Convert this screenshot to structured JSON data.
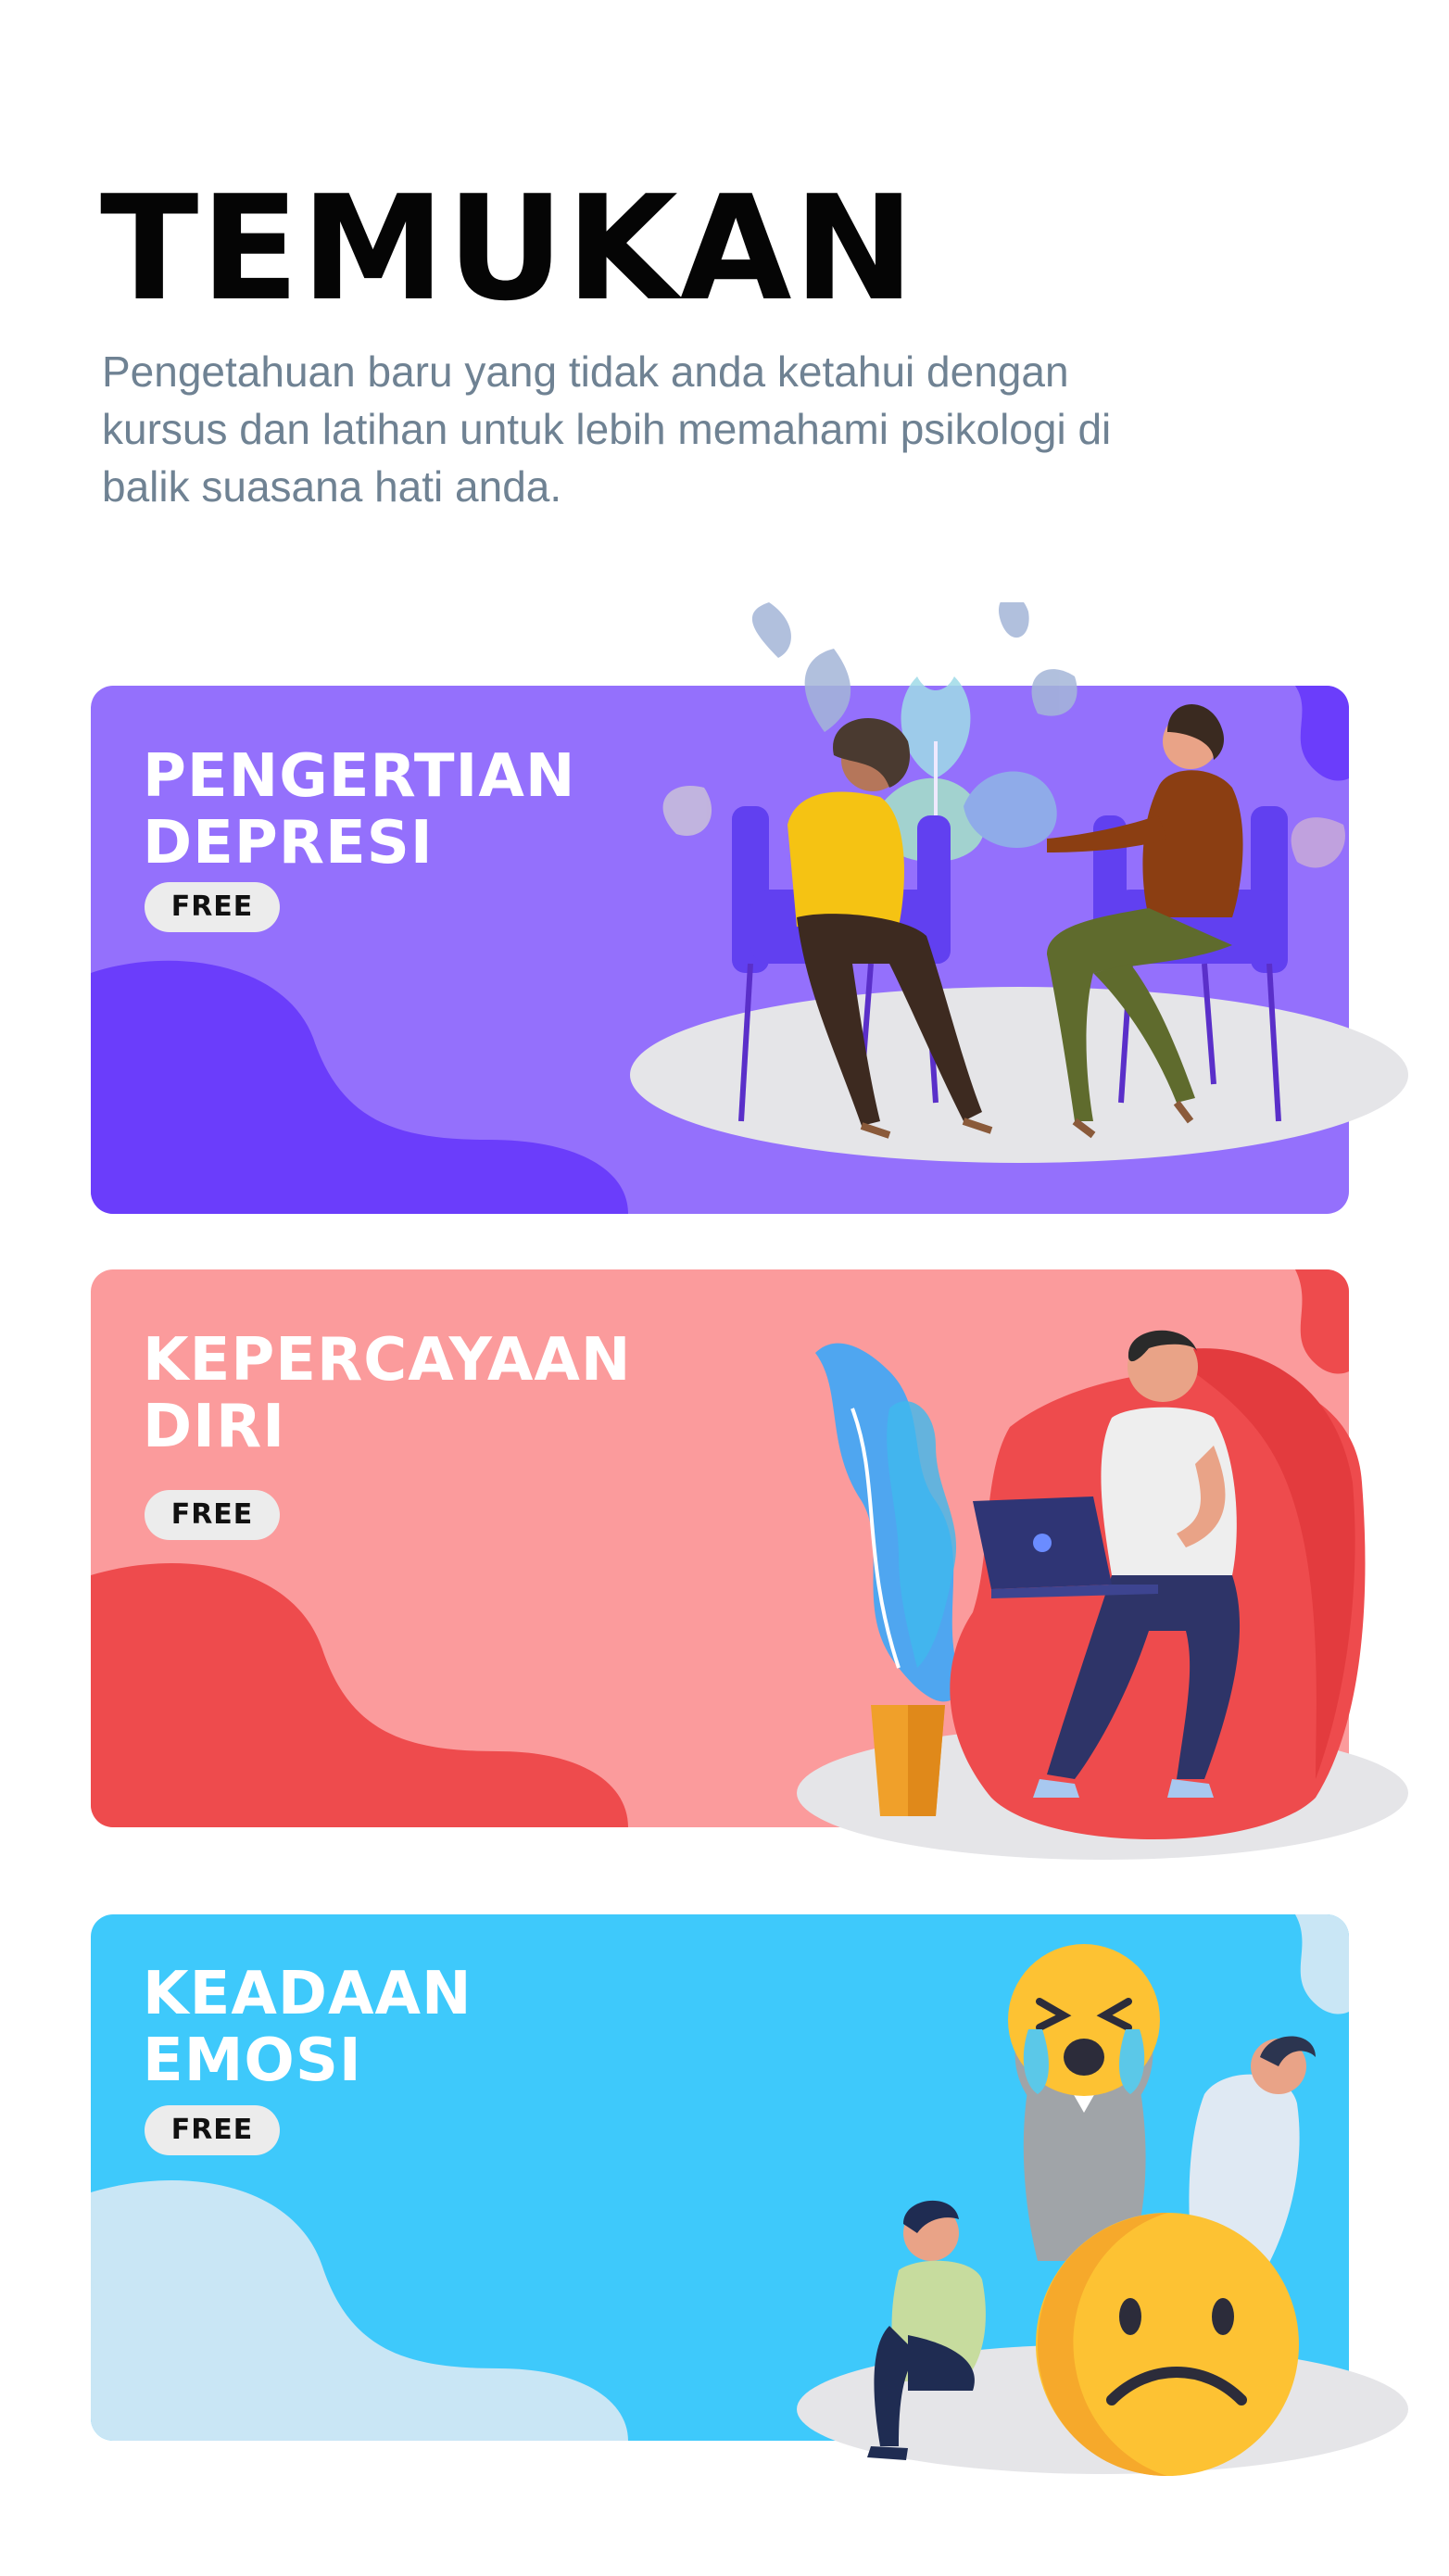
{
  "header": {
    "title": "TEMUKAN",
    "subtitle": "Pengetahuan baru yang tidak anda ketahui dengan kursus dan latihan untuk lebih memahami psikologi di balik suasana hati anda."
  },
  "courses": [
    {
      "title_line1": "PENGERTIAN",
      "title_line2": "DEPRESI",
      "badge": "FREE",
      "bg_color": "#9470fc",
      "blob_color": "#6b3dfb",
      "illustration": "therapy-session-illustration"
    },
    {
      "title_line1": "KEPERCAYAAN",
      "title_line2": "DIRI",
      "badge": "FREE",
      "bg_color": "#fb9b9c",
      "blob_color": "#ee4b4d",
      "illustration": "man-with-laptop-illustration"
    },
    {
      "title_line1": "KEADAAN",
      "title_line2": "EMOSI",
      "badge": "FREE",
      "bg_color": "#3ec9fb",
      "blob_color": "#c9e6f5",
      "illustration": "sad-emoji-people-illustration"
    }
  ]
}
